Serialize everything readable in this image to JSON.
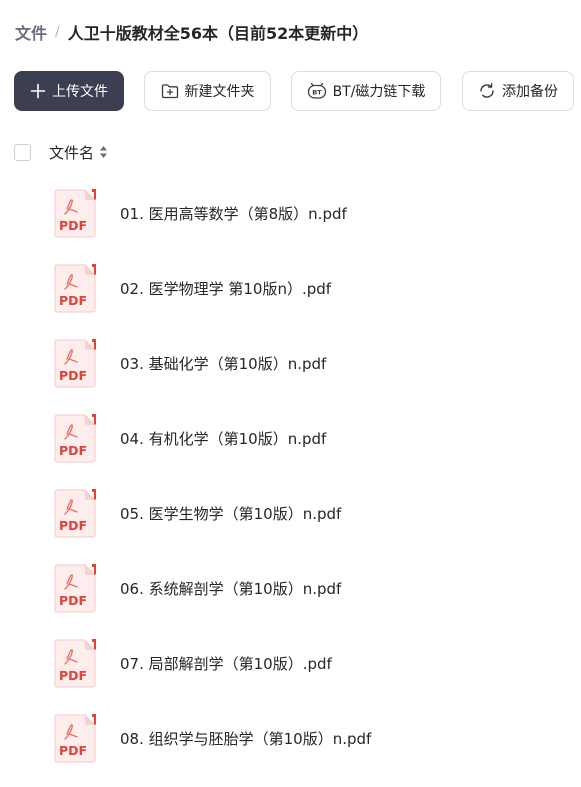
{
  "breadcrumb": {
    "root": "文件",
    "separator": "/",
    "current": "人卫十版教材全56本（目前52本更新中）"
  },
  "toolbar": {
    "upload_label": "上传文件",
    "new_folder_label": "新建文件夹",
    "bt_label": "BT/磁力链下载",
    "backup_label": "添加备份"
  },
  "list_header": {
    "name_column": "文件名"
  },
  "file_icon_text": "PDF",
  "colors": {
    "primary_button": "#3c3f51",
    "pdf_red": "#e0433a",
    "pdf_bg": "#fde8e6",
    "text": "#25262b"
  },
  "files": [
    {
      "name": "01. 医用高等数学（第8版）n.pdf",
      "icon": "pdf-icon"
    },
    {
      "name": "02. 医学物理学 第10版n）.pdf",
      "icon": "pdf-icon"
    },
    {
      "name": "03. 基础化学（第10版）n.pdf",
      "icon": "pdf-icon"
    },
    {
      "name": "04. 有机化学（第10版）n.pdf",
      "icon": "pdf-icon"
    },
    {
      "name": "05. 医学生物学（第10版）n.pdf",
      "icon": "pdf-icon"
    },
    {
      "name": "06. 系统解剖学（第10版）n.pdf",
      "icon": "pdf-icon"
    },
    {
      "name": "07. 局部解剖学（第10版）.pdf",
      "icon": "pdf-icon"
    },
    {
      "name": "08. 组织学与胚胎学（第10版）n.pdf",
      "icon": "pdf-icon"
    }
  ]
}
